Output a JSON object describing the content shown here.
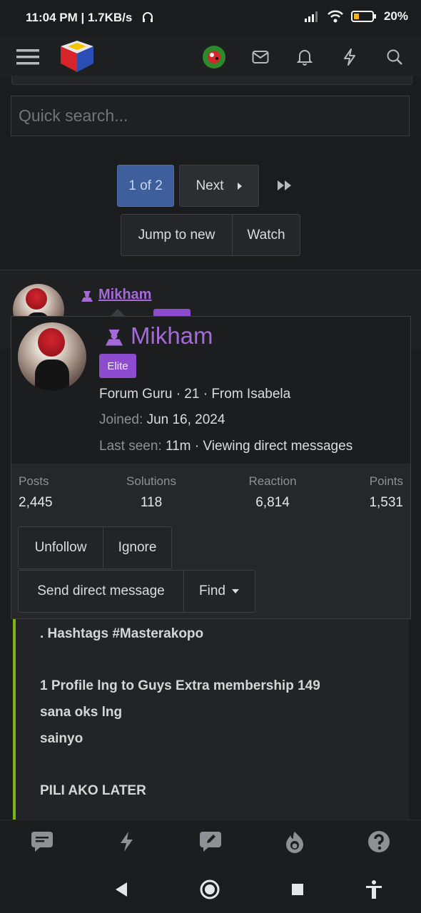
{
  "status_bar": {
    "time_speed": "11:04 PM | 1.7KB/s",
    "battery": "20%",
    "battery_sub": ""
  },
  "search": {
    "placeholder": "Quick search..."
  },
  "pagination": {
    "current": "1 of 2",
    "next_label": "Next"
  },
  "thread_actions": {
    "jump": "Jump to new",
    "watch": "Watch"
  },
  "post": {
    "author": "Mikham"
  },
  "popup": {
    "name": "Mikham",
    "badge": "Elite",
    "info": "Forum Guru · 21 · From Isabela",
    "joined_label": "Joined:",
    "joined_value": "Jun 16, 2024",
    "last_seen_label": "Last seen:",
    "last_seen_value": "11m · Viewing direct messages",
    "stats": [
      {
        "label": "Posts",
        "value": "2,445"
      },
      {
        "label": "Solutions",
        "value": "118"
      },
      {
        "label": "Reaction",
        "value": "6,814"
      },
      {
        "label": "Points",
        "value": "1,531"
      }
    ],
    "buttons": {
      "unfollow": "Unfollow",
      "ignore": "Ignore",
      "send_dm": "Send direct message",
      "find": "Find"
    }
  },
  "post_content": {
    "line1": ". Hashtags #Masterakopo",
    "line2": "1 Profile lng to Guys Extra membership 149",
    "line3": "sana oks lng",
    "line4": "sainyo",
    "line5": "PILI AKO LATER"
  },
  "colors": {
    "accent_purple": "#a56ad8",
    "badge_purple": "#8d4bd0",
    "page_blue": "#3e5f9c",
    "quote_green": "#7cb518"
  }
}
